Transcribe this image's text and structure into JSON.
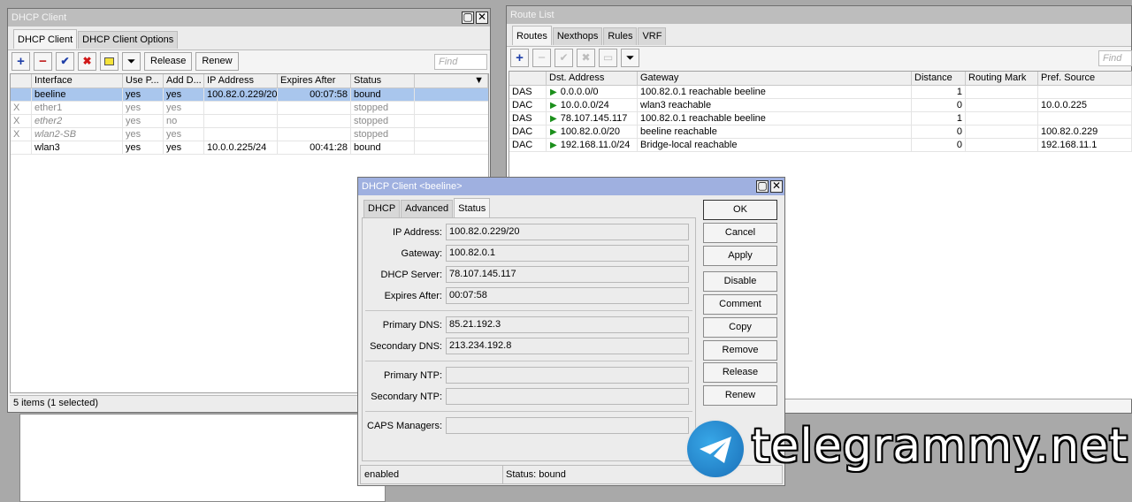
{
  "dhcp_window": {
    "title": "DHCP Client",
    "tabs": [
      "DHCP Client",
      "DHCP Client Options"
    ],
    "buttons": {
      "release": "Release",
      "renew": "Renew"
    },
    "find_placeholder": "Find",
    "columns": [
      "Interface",
      "Use P...",
      "Add D...",
      "IP Address",
      "Expires After",
      "Status"
    ],
    "rows": [
      {
        "flag": "",
        "iface": "beeline",
        "use": "yes",
        "add": "yes",
        "ip": "100.82.0.229/20",
        "exp": "00:07:58",
        "status": "bound"
      },
      {
        "flag": "X",
        "iface": "ether1",
        "use": "yes",
        "add": "yes",
        "ip": "",
        "exp": "",
        "status": "stopped"
      },
      {
        "flag": "X",
        "iface": "ether2",
        "use": "yes",
        "add": "no",
        "ip": "",
        "exp": "",
        "status": "stopped"
      },
      {
        "flag": "X",
        "iface": "wlan2-SB",
        "use": "yes",
        "add": "yes",
        "ip": "",
        "exp": "",
        "status": "stopped"
      },
      {
        "flag": "",
        "iface": "wlan3",
        "use": "yes",
        "add": "yes",
        "ip": "10.0.0.225/24",
        "exp": "00:41:28",
        "status": "bound"
      }
    ],
    "status": "5 items (1 selected)"
  },
  "route_window": {
    "title": "Route List",
    "tabs": [
      "Routes",
      "Nexthops",
      "Rules",
      "VRF"
    ],
    "find_placeholder": "Find",
    "columns": [
      "Dst. Address",
      "Gateway",
      "Distance",
      "Routing Mark",
      "Pref. Source"
    ],
    "rows": [
      {
        "type": "DAS",
        "dst": "0.0.0.0/0",
        "gw": "100.82.0.1 reachable beeline",
        "dist": "1",
        "mark": "",
        "src": ""
      },
      {
        "type": "DAC",
        "dst": "10.0.0.0/24",
        "gw": "wlan3 reachable",
        "dist": "0",
        "mark": "",
        "src": "10.0.0.225"
      },
      {
        "type": "DAS",
        "dst": "78.107.145.117",
        "gw": "100.82.0.1 reachable beeline",
        "dist": "1",
        "mark": "",
        "src": ""
      },
      {
        "type": "DAC",
        "dst": "100.82.0.0/20",
        "gw": "beeline reachable",
        "dist": "0",
        "mark": "",
        "src": "100.82.0.229"
      },
      {
        "type": "DAC",
        "dst": "192.168.11.0/24",
        "gw": "Bridge-local reachable",
        "dist": "0",
        "mark": "",
        "src": "192.168.11.1"
      }
    ]
  },
  "dialog": {
    "title": "DHCP Client <beeline>",
    "tabs": [
      "DHCP",
      "Advanced",
      "Status"
    ],
    "fields": {
      "ip_label": "IP Address:",
      "ip": "100.82.0.229/20",
      "gw_label": "Gateway:",
      "gw": "100.82.0.1",
      "server_label": "DHCP Server:",
      "server": "78.107.145.117",
      "exp_label": "Expires After:",
      "exp": "00:07:58",
      "pdns_label": "Primary DNS:",
      "pdns": "85.21.192.3",
      "sdns_label": "Secondary DNS:",
      "sdns": "213.234.192.8",
      "pntp_label": "Primary NTP:",
      "pntp": "",
      "sntp_label": "Secondary NTP:",
      "sntp": "",
      "caps_label": "CAPS Managers:",
      "caps": ""
    },
    "buttons": [
      "OK",
      "Cancel",
      "Apply",
      "Disable",
      "Comment",
      "Copy",
      "Remove",
      "Release",
      "Renew"
    ],
    "status_left": "enabled",
    "status_right": "Status: bound"
  },
  "watermark": "telegrammy.net"
}
